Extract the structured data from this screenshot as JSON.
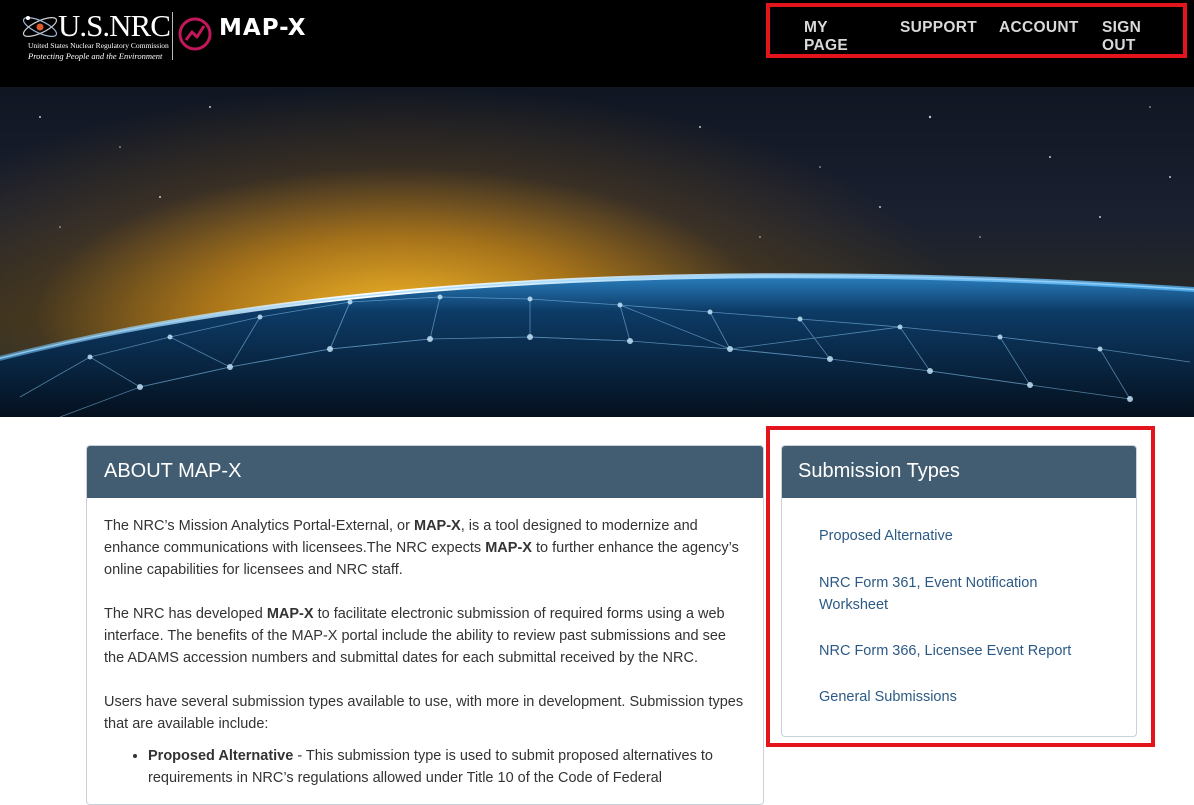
{
  "header": {
    "nrc_wordmark": "U.S.NRC",
    "nrc_subtitle": "United States Nuclear Regulatory Commission",
    "nrc_tagline": "Protecting People and the Environment",
    "app_name": "MAP-X",
    "nav": [
      "MY PAGE",
      "SUPPORT",
      "ACCOUNT",
      "SIGN OUT"
    ]
  },
  "about": {
    "title": "ABOUT MAP-X",
    "p1_a": "The NRC’s Mission Analytics Portal-External, or ",
    "p1_b": "MAP-X",
    "p1_c": ", is a tool designed to modernize and enhance communications with licensees.The NRC expects ",
    "p1_d": "MAP-X",
    "p1_e": " to further enhance the agency’s online capabilities for licensees and NRC staff.",
    "p2_a": "The NRC has developed ",
    "p2_b": "MAP-X",
    "p2_c": " to facilitate electronic submission of required forms using a web interface. The benefits of the MAP-X portal include the ability to review past submissions and see the ADAMS accession numbers and submittal dates for each submittal received by the NRC.",
    "p3": "Users have several submission types available to use, with more in development. Submission types that are available include:",
    "bullet1_bold": "Proposed Alternative",
    "bullet1_text": " - This submission type is used to submit proposed alternatives to requirements in NRC’s regulations allowed under Title 10 of the Code of Federal"
  },
  "submission_types": {
    "title": "Submission Types",
    "items": [
      "Proposed Alternative",
      "NRC Form 361, Event Notification Worksheet",
      "NRC Form 366, Licensee Event Report",
      "General Submissions"
    ]
  },
  "colors": {
    "header_bg": "#000000",
    "card_header": "#425c71",
    "link": "#2c5a85",
    "highlight": "#e3141c"
  }
}
